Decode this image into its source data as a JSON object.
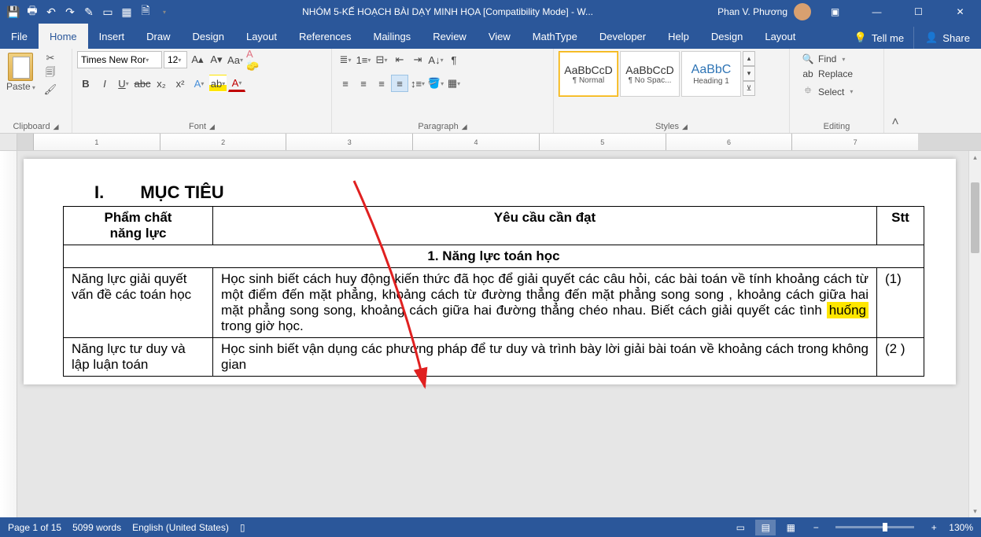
{
  "titlebar": {
    "doc_title": "NHÓM 5-KẾ HOẠCH BÀI DẠY MINH HỌA [Compatibility Mode]  -  W...",
    "user_name": "Phan V. Phương"
  },
  "tabs": {
    "file": "File",
    "home": "Home",
    "insert": "Insert",
    "draw": "Draw",
    "design": "Design",
    "layout": "Layout",
    "references": "References",
    "mailings": "Mailings",
    "review": "Review",
    "view": "View",
    "mathtype": "MathType",
    "developer": "Developer",
    "help": "Help",
    "design2": "Design",
    "layout2": "Layout",
    "tell_me": "Tell me",
    "share": "Share"
  },
  "ribbon": {
    "clipboard": {
      "label": "Clipboard",
      "paste": "Paste"
    },
    "font": {
      "label": "Font",
      "name": "Times New Ror",
      "size": "12"
    },
    "paragraph": {
      "label": "Paragraph"
    },
    "styles": {
      "label": "Styles",
      "preview": "AaBbCcD",
      "preview_h": "AaBbC",
      "normal": "¶ Normal",
      "no_spacing": "¶ No Spac...",
      "heading1": "Heading 1"
    },
    "editing": {
      "label": "Editing",
      "find": "Find",
      "replace": "Replace",
      "select": "Select"
    }
  },
  "ruler": {
    "n1": "1",
    "n2": "2",
    "n3": "3",
    "n4": "4",
    "n5": "5",
    "n6": "6",
    "n7": "7"
  },
  "document": {
    "heading": {
      "num": "I.",
      "text": "MỤC TIÊU"
    },
    "headers": {
      "c1_l1": "Phẩm chất",
      "c1_l2": "năng lực",
      "c2": "Yêu cầu cần đạt",
      "c3": "Stt"
    },
    "section1": "1.   Năng lực toán học",
    "row1": {
      "c1": "Năng lực giải quyết vấn đề các toán học",
      "c2_a": "Học sinh biết cách huy động kiến thức đã học để giải quyết các câu hỏi, các bài toán về tính khoảng cách từ một điểm đến mặt phẳng, khoảng cách từ đường thẳng đến mặt phẳng song song , khoảng cách giữa hai mặt phẳng song song, khoảng cách giữa hai đường thẳng chéo nhau. Biết cách giải quyết các tình ",
      "c2_hl": "huống",
      "c2_b": "   trong giờ học.",
      "c3": "(1)"
    },
    "row2": {
      "c1": "Năng lực tư duy và lập luận toán",
      "c2": "Học sinh biết vận dụng các phương pháp để tư duy và trình bày lời giải bài toán về khoảng cách trong không gian",
      "c3": "(2 )"
    }
  },
  "statusbar": {
    "page": "Page 1 of 15",
    "words": "5099 words",
    "lang": "English (United States)",
    "zoom": "130%"
  }
}
